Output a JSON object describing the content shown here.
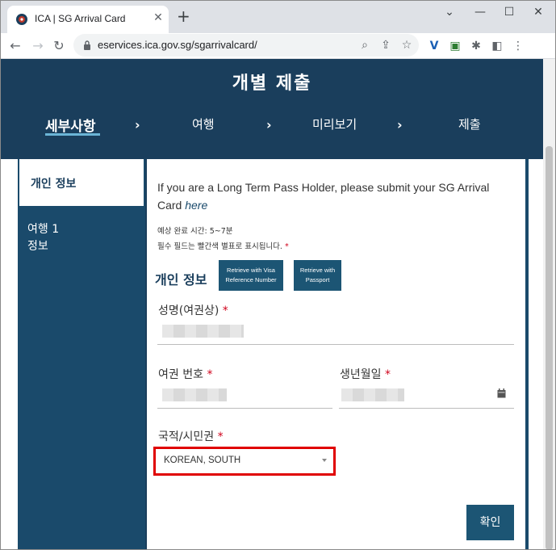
{
  "browser": {
    "tab_title": "ICA | SG Arrival Card",
    "new_tab": "+",
    "url": "eservices.ica.gov.sg/sgarrivalcard/",
    "window_controls": {
      "minimize": "—",
      "maximize": "☐",
      "close": "✕"
    },
    "nav": {
      "back": "←",
      "forward": "→",
      "reload": "↻"
    }
  },
  "header": {
    "title": "개별 제출",
    "steps": [
      {
        "label": "세부사항",
        "active": true
      },
      {
        "label": "여행",
        "active": false
      },
      {
        "label": "미리보기",
        "active": false
      },
      {
        "label": "제출",
        "active": false
      }
    ],
    "chevron": "›"
  },
  "sidebar": {
    "items": [
      {
        "label": "개인 정보",
        "active": true
      },
      {
        "label": "여행 1\n정보",
        "active": false
      }
    ]
  },
  "form": {
    "notice_text": "If you are a Long Term Pass Holder, please submit your SG Arrival Card ",
    "notice_link": "here",
    "estimate": "예상 완료 시간: 5~7분",
    "required_note": "필수 필드는 빨간색 별표로 표시됩니다.",
    "required_mark": "*",
    "section_title": "개인 정보",
    "retrieve_visa": "Retrieve with Visa\nReference Number",
    "retrieve_passport": "Retrieve with\nPassport",
    "fields": {
      "name_label": "성명(여권상)",
      "passport_label": "여권 번호",
      "dob_label": "생년월일",
      "nationality_label": "국적/시민권",
      "nationality_value": "KOREAN, SOUTH"
    },
    "confirm_label": "확인"
  },
  "colors": {
    "header_bg": "#1a3e5c",
    "button_bg": "#1c5574",
    "highlight": "#e00000",
    "required": "#d0021b"
  }
}
